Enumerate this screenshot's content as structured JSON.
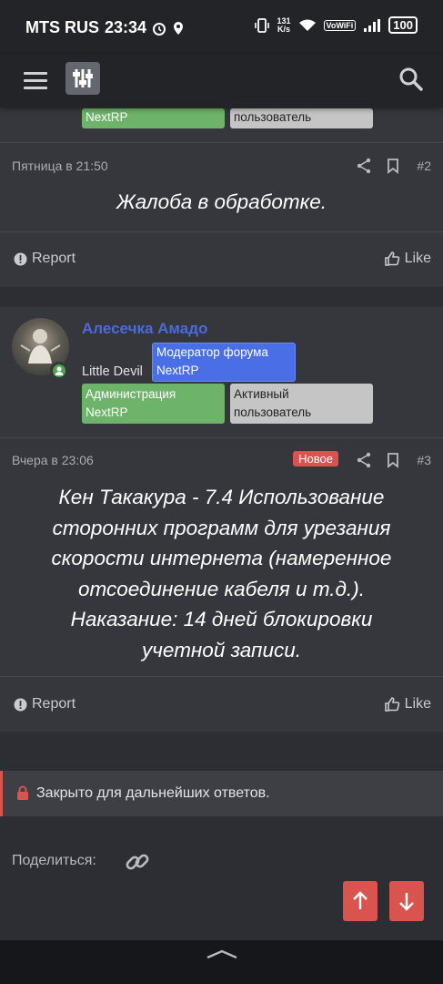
{
  "status_bar": {
    "carrier": "MTS RUS",
    "time": "23:34",
    "net_speed": "131",
    "net_unit": "K/s",
    "vowifi": "VoWiFi",
    "battery": "100"
  },
  "post1": {
    "tag_green_partial": "NextRP",
    "tag_gray_partial": "пользователь",
    "date": "Пятница в 21:50",
    "number": "#2",
    "text": "Жалоба в обработке.",
    "report_label": "Report",
    "like_label": "Like"
  },
  "post2": {
    "username": "Алесечка Амадо",
    "user_title": "Little Devil",
    "tag_moderator": [
      "Модератор форума",
      "NextRP"
    ],
    "tag_admin": [
      "Администрация",
      "NextRP"
    ],
    "tag_active": [
      "Активный",
      "пользователь"
    ],
    "date": "Вчера в 23:06",
    "new_badge": "Новое",
    "number": "#3",
    "text_lines": [
      "Кен Такакура - 7.4 Использование",
      "сторонних программ для урезания",
      "скорости интернета (намеренное",
      "отсоединение кабеля и т.д.).",
      "Наказание: 14 дней блокировки",
      "учетной записи."
    ],
    "report_label": "Report",
    "like_label": "Like"
  },
  "closed_notice": "Закрыто для дальнейших ответов.",
  "share_label": "Поделиться:",
  "colors": {
    "accent_red": "#d9534f",
    "tag_green": "#6db46a",
    "tag_blue": "#4a6ee6",
    "username_blue": "#4b6bdc"
  }
}
